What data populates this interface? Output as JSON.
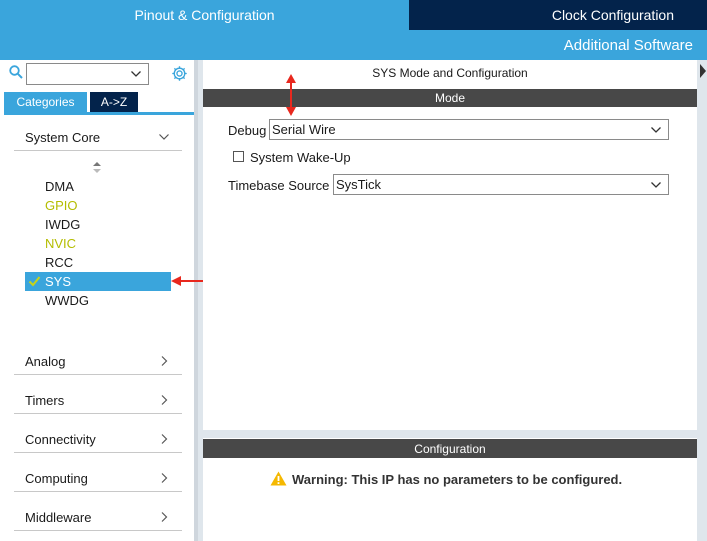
{
  "top_tabs": {
    "pinout": "Pinout & Configuration",
    "clock": "Clock Configuration",
    "additional": "Additional Software"
  },
  "left": {
    "search_value": "",
    "tabs": {
      "categories": "Categories",
      "az": "A->Z"
    },
    "sections": {
      "system_core": "System Core",
      "analog": "Analog",
      "timers": "Timers",
      "connectivity": "Connectivity",
      "computing": "Computing",
      "middleware": "Middleware"
    },
    "core_items": [
      "DMA",
      "GPIO",
      "IWDG",
      "NVIC",
      "RCC",
      "SYS",
      "WWDG"
    ],
    "selected_item": "SYS"
  },
  "mode": {
    "title": "SYS Mode and Configuration",
    "bar": "Mode",
    "debug_label": "Debug",
    "debug_value": "Serial Wire",
    "wakeup_label": "System Wake-Up",
    "wakeup_checked": false,
    "timebase_label": "Timebase Source",
    "timebase_value": "SysTick"
  },
  "config": {
    "bar": "Configuration",
    "warning": "Warning: This IP has no parameters to be configured."
  },
  "colors": {
    "accent_blue": "#3aa5dc",
    "dark_navy": "#03234b",
    "header_gray": "#484848",
    "yellow_item": "#b4bd00",
    "annotation_red": "#e8281e"
  },
  "icons": [
    "search-icon",
    "chevron-down-icon",
    "gear-icon",
    "sort-icon",
    "check-icon",
    "chevron-right-icon",
    "warning-icon"
  ]
}
